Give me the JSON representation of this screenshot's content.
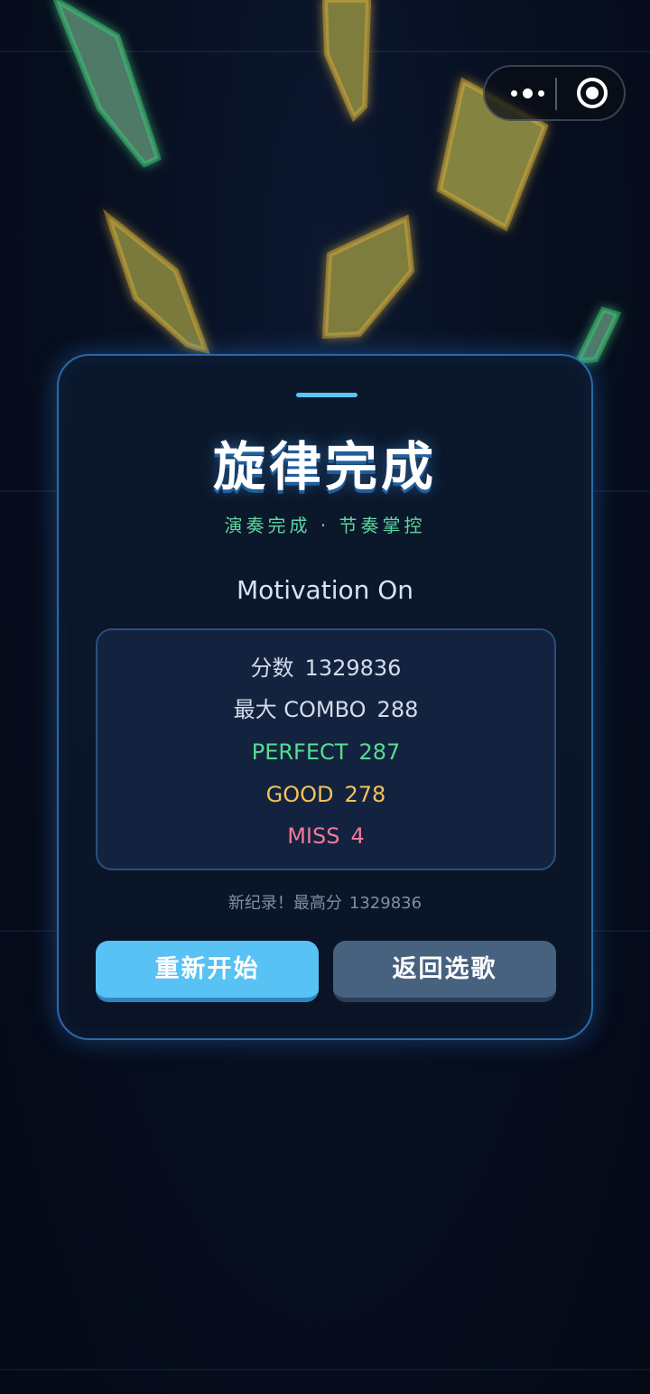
{
  "colors": {
    "card_border": "#2b6aa8",
    "accent_blue": "#58c2f5",
    "perfect": "#58dc8f",
    "good": "#f2c35a",
    "miss": "#f07a9b",
    "subtitle": "#5fd6a0",
    "shard_yellow": "#8a8a3c",
    "shard_green": "#5a8a6a"
  },
  "capsule": {
    "more_icon": "more-dots-icon",
    "close_icon": "target-circle-icon"
  },
  "result": {
    "title": "旋律完成",
    "subtitle": "演奏完成 · 节奏掌控",
    "song_name": "Motivation On"
  },
  "stats": {
    "score_label": "分数",
    "score_value": "1329836",
    "combo_label": "最大 COMBO",
    "combo_value": "288",
    "perfect_label": "PERFECT",
    "perfect_value": "287",
    "good_label": "GOOD",
    "good_value": "278",
    "miss_label": "MISS",
    "miss_value": "4"
  },
  "record": {
    "label": "新纪录！最高分",
    "value": "1329836"
  },
  "buttons": {
    "restart_label": "重新开始",
    "back_label": "返回选歌"
  }
}
